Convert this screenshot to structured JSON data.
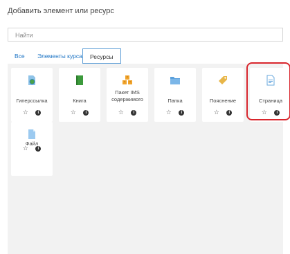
{
  "header": {
    "title": "Добавить элемент или ресурс"
  },
  "search": {
    "placeholder": "Найти"
  },
  "tabs": [
    {
      "label": "Все",
      "active": false
    },
    {
      "label": "Элементы курса",
      "active": false
    },
    {
      "label": "Ресурсы",
      "active": true
    }
  ],
  "resources": [
    {
      "label": "Гиперссылка",
      "icon": "url-globe-icon"
    },
    {
      "label": "Книга",
      "icon": "book-icon"
    },
    {
      "label": "Пакет IMS содержимого",
      "icon": "ims-package-icon"
    },
    {
      "label": "Папка",
      "icon": "folder-icon"
    },
    {
      "label": "Пояснение",
      "icon": "label-tag-icon"
    },
    {
      "label": "Страница",
      "icon": "page-icon"
    },
    {
      "label": "Файл",
      "icon": "file-icon"
    }
  ],
  "colors": {
    "accent": "#1b73c4",
    "highlight": "#d8262d",
    "panel": "#f2f2f2"
  }
}
